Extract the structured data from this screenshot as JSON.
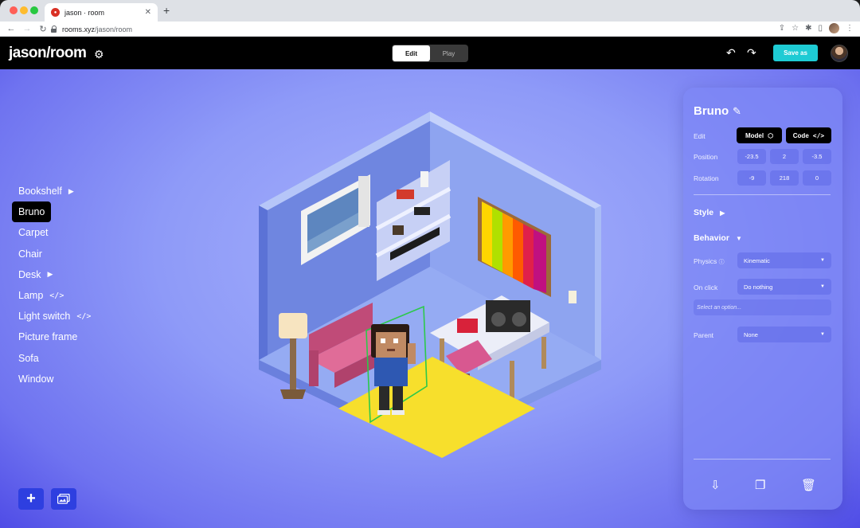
{
  "browser": {
    "tab_title": "jason · room",
    "url_host": "rooms.xyz",
    "url_path": "/jason/room"
  },
  "header": {
    "title": "jason/room",
    "mode_edit": "Edit",
    "mode_play": "Play",
    "active_mode": "Edit",
    "save_label": "Save as",
    "accent_color": "#1ecbd4"
  },
  "objects": {
    "items": [
      {
        "label": "Bookshelf",
        "marker": "arrow"
      },
      {
        "label": "Bruno",
        "marker": "none",
        "selected": true
      },
      {
        "label": "Carpet",
        "marker": "none"
      },
      {
        "label": "Chair",
        "marker": "none"
      },
      {
        "label": "Desk",
        "marker": "arrow"
      },
      {
        "label": "Lamp",
        "marker": "code"
      },
      {
        "label": "Light switch",
        "marker": "code"
      },
      {
        "label": "Picture frame",
        "marker": "none"
      },
      {
        "label": "Sofa",
        "marker": "none"
      },
      {
        "label": "Window",
        "marker": "none"
      }
    ],
    "add_icon": "plus-icon",
    "gallery_icon": "gallery-icon"
  },
  "inspector": {
    "name": "Bruno",
    "edit_label": "Edit",
    "model_label": "Model",
    "code_label": "Code",
    "position_label": "Position",
    "position": [
      "-23.5",
      "2",
      "-3.5"
    ],
    "rotation_label": "Rotation",
    "rotation": [
      "-9",
      "218",
      "0"
    ],
    "style_label": "Style",
    "behavior_label": "Behavior",
    "physics_label": "Physics",
    "physics_value": "Kinematic",
    "onclick_label": "On click",
    "onclick_value": "Do nothing",
    "onclick_hint": "Select an option...",
    "parent_label": "Parent",
    "parent_value": "None"
  }
}
